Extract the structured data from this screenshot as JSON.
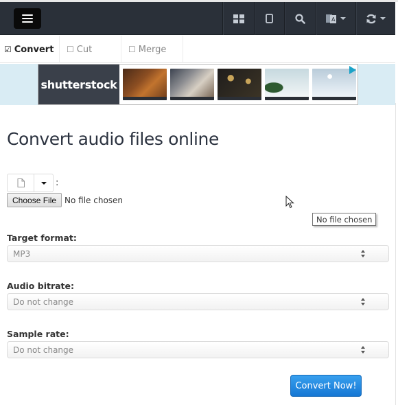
{
  "navbar": {
    "menu_icon": "hamburger-icon",
    "items": [
      {
        "icon": "grid-icon",
        "has_caret": false
      },
      {
        "icon": "tablet-icon",
        "has_caret": false
      },
      {
        "icon": "search-icon",
        "has_caret": false
      },
      {
        "icon": "translate-icon",
        "has_caret": true
      },
      {
        "icon": "refresh-icon",
        "has_caret": true
      }
    ]
  },
  "tabs": [
    {
      "label": "Convert",
      "icon": "checked-box-icon",
      "active": true
    },
    {
      "label": "Cut",
      "icon": "unchecked-box-icon",
      "active": false
    },
    {
      "label": "Merge",
      "icon": "unchecked-box-icon",
      "active": false
    }
  ],
  "ad": {
    "brand": "shutterstock",
    "adchoices_icon": "adchoices-icon"
  },
  "main": {
    "title": "Convert audio files online",
    "source": {
      "file_icon": "file-icon",
      "colon": ":"
    },
    "file_input": {
      "button_label": "Choose File",
      "status": "No file chosen"
    },
    "tooltip": "No file chosen",
    "fields": [
      {
        "label": "Target format:",
        "value": "MP3"
      },
      {
        "label": "Audio bitrate:",
        "value": "Do not change"
      },
      {
        "label": "Sample rate:",
        "value": "Do not change"
      }
    ],
    "submit_label": "Convert Now!"
  },
  "colors": {
    "navbar": "#2a3039",
    "accent": "#1a85e0",
    "ad_bg": "#d9ecf4"
  }
}
